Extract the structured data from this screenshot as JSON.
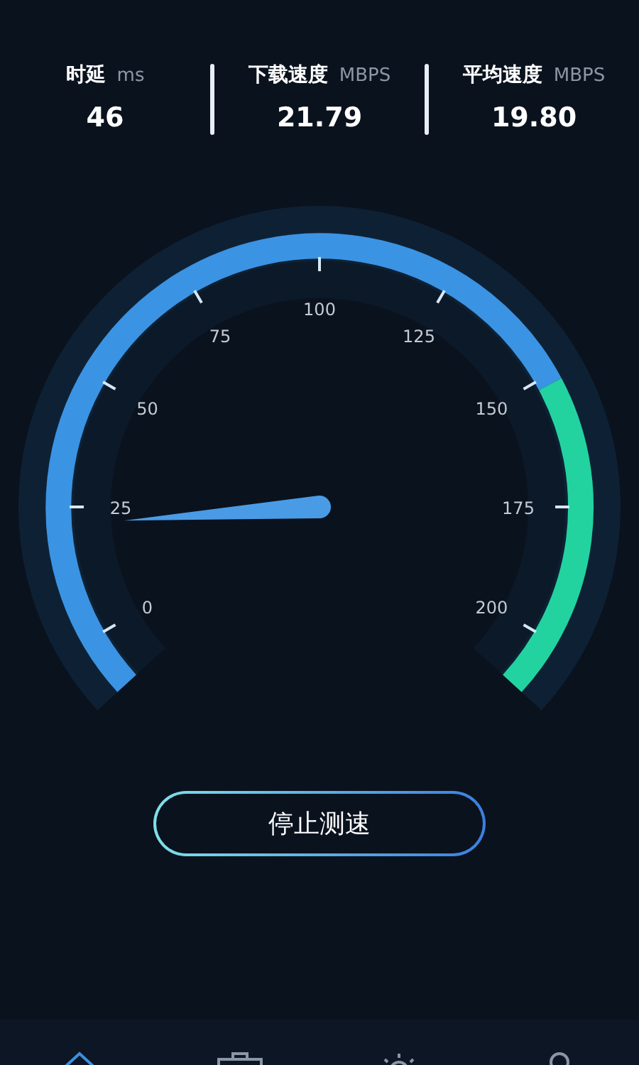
{
  "stats": [
    {
      "label": "时延",
      "unit": "ms",
      "value": "46"
    },
    {
      "label": "下载速度",
      "unit": "MBPS",
      "value": "21.79"
    },
    {
      "label": "平均速度",
      "unit": "MBPS",
      "value": "19.80"
    }
  ],
  "gauge": {
    "scale": [
      "0",
      "25",
      "50",
      "75",
      "100",
      "125",
      "150",
      "175",
      "200"
    ]
  },
  "stop_button": "停止测速",
  "bottom_nav": [
    {
      "selected": true
    },
    {
      "selected": false
    },
    {
      "selected": false
    },
    {
      "selected": false
    }
  ]
}
